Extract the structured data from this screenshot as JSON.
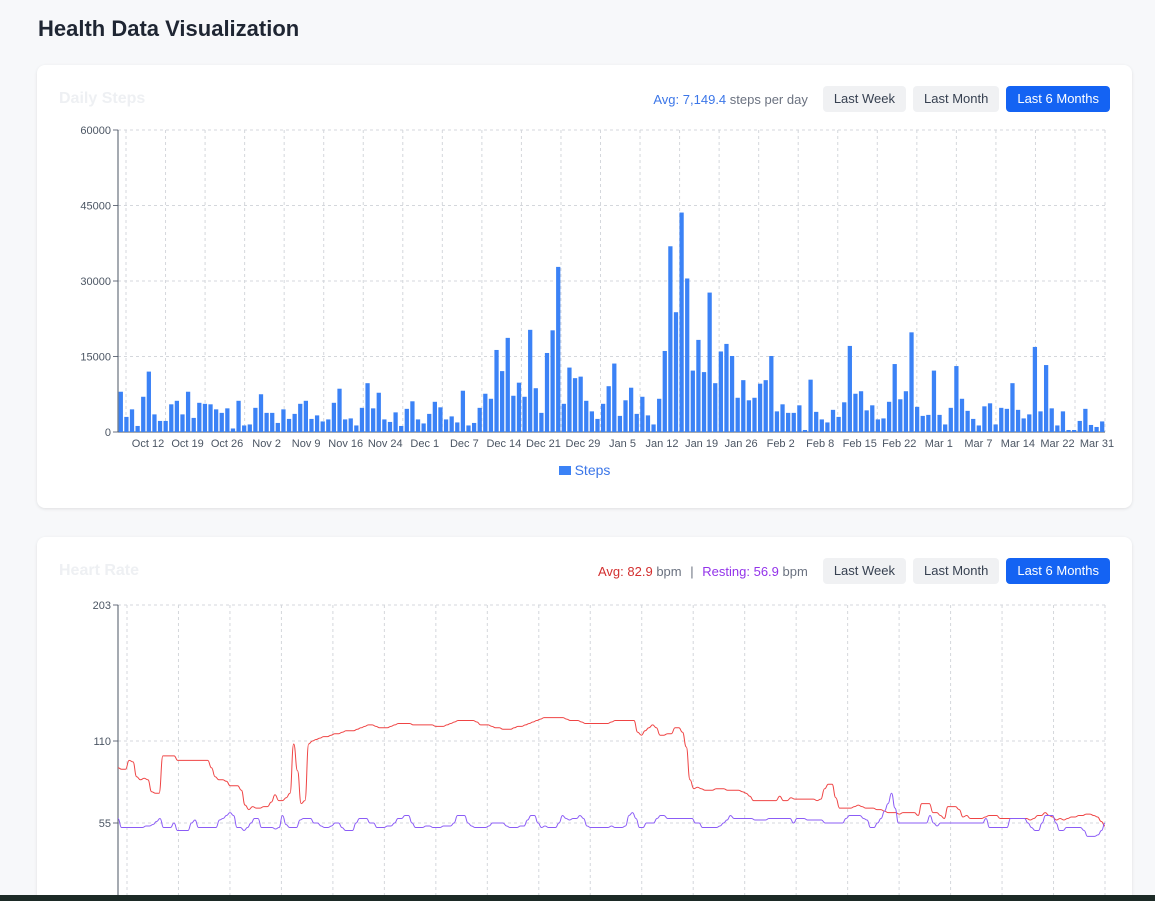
{
  "page": {
    "title": "Health Data Visualization"
  },
  "steps_panel": {
    "title": "Daily Steps",
    "avg_label": "Avg:",
    "avg_value": "7,149.4",
    "avg_unit": "steps per day",
    "buttons": [
      "Last Week",
      "Last Month",
      "Last 6 Months"
    ],
    "active_button": "Last 6 Months",
    "legend": "Steps"
  },
  "hr_panel": {
    "title": "Heart Rate",
    "avg_label": "Avg:",
    "avg_value": "82.9",
    "avg_unit": "bpm",
    "separator": "|",
    "resting_label": "Resting:",
    "resting_value": "56.9",
    "resting_unit": "bpm",
    "buttons": [
      "Last Week",
      "Last Month",
      "Last 6 Months"
    ],
    "active_button": "Last 6 Months"
  },
  "colors": {
    "steps_bar": "#3b82f6",
    "hr_avg": "#ef4444",
    "hr_resting": "#8b5cf6",
    "accent": "#1463f3"
  },
  "chart_data": [
    {
      "type": "bar",
      "title": "Daily Steps",
      "ylim": [
        0,
        60000
      ],
      "y_ticks": [
        0,
        15000,
        30000,
        45000,
        60000
      ],
      "x_ticks": [
        "Oct 12",
        "Oct 19",
        "Oct 26",
        "Nov 2",
        "Nov 9",
        "Nov 16",
        "Nov 24",
        "Dec 1",
        "Dec 7",
        "Dec 14",
        "Dec 21",
        "Dec 29",
        "Jan 5",
        "Jan 12",
        "Jan 19",
        "Jan 26",
        "Feb 2",
        "Feb 8",
        "Feb 15",
        "Feb 22",
        "Mar 1",
        "Mar 7",
        "Mar 14",
        "Mar 22",
        "Mar 31"
      ],
      "grid": true,
      "legend_position": "bottom",
      "series": [
        {
          "name": "Steps",
          "values": [
            8000,
            3000,
            4500,
            1200,
            7000,
            12000,
            3500,
            2200,
            2200,
            5500,
            6200,
            3500,
            8000,
            2800,
            5800,
            5600,
            5500,
            4500,
            3800,
            4700,
            700,
            6200,
            1300,
            1500,
            4800,
            7500,
            3800,
            3800,
            1800,
            4500,
            2600,
            3600,
            5600,
            6200,
            2600,
            3300,
            2100,
            2500,
            5800,
            8600,
            2500,
            2700,
            1300,
            4800,
            9700,
            4700,
            7800,
            2500,
            2000,
            3900,
            1200,
            4600,
            6100,
            2500,
            1700,
            3600,
            6000,
            4900,
            2500,
            3100,
            1900,
            8200,
            1300,
            1800,
            4800,
            7600,
            6600,
            16300,
            12100,
            18700,
            7200,
            9800,
            7000,
            20300,
            8700,
            3800,
            15700,
            20200,
            32800,
            5600,
            12800,
            10700,
            11000,
            6200,
            4100,
            2600,
            5600,
            9100,
            13600,
            3200,
            6300,
            8800,
            3600,
            7000,
            3300,
            1500,
            6600,
            16100,
            36900,
            23800,
            43600,
            30500,
            12200,
            18300,
            11900,
            27700,
            9700,
            16000,
            17500,
            15100,
            6800,
            10300,
            6300,
            6800,
            9600,
            10300,
            15100,
            4100,
            5500,
            3800,
            3800,
            5300,
            400,
            10400,
            4000,
            2500,
            1900,
            4400,
            3000,
            5900,
            17100,
            7600,
            8100,
            4300,
            5300,
            2500,
            2700,
            6000,
            13500,
            6500,
            8100,
            19800,
            5000,
            3200,
            3400,
            12200,
            3400,
            1500,
            4800,
            13100,
            6600,
            4200,
            2600,
            1300,
            5100,
            5700,
            1500,
            4800,
            4600,
            9700,
            4400,
            2700,
            3500,
            16900,
            4100,
            13300,
            4700,
            1300,
            4100,
            400,
            400,
            2200,
            4600,
            1400,
            1000,
            2100
          ]
        }
      ]
    },
    {
      "type": "line",
      "title": "Heart Rate",
      "y_ticks": [
        55,
        110,
        203
      ],
      "series": [
        {
          "name": "Avg",
          "values": [
            92,
            91,
            91,
            97,
            96,
            86,
            84,
            85,
            84,
            76,
            75,
            75,
            100,
            100,
            100,
            100,
            97,
            97,
            97,
            97,
            97,
            97,
            97,
            97,
            97,
            92,
            86,
            84,
            84,
            83,
            80,
            80,
            80,
            77,
            67,
            64,
            66,
            65,
            65,
            66,
            66,
            69,
            74,
            70,
            70,
            72,
            75,
            108,
            90,
            68,
            70,
            108,
            110,
            111,
            112,
            113,
            113,
            114,
            115,
            115,
            116,
            117,
            117,
            117,
            118,
            119,
            120,
            121,
            121,
            120,
            119,
            119,
            119,
            120,
            121,
            122,
            122,
            122,
            122,
            121,
            121,
            121,
            121,
            121,
            121,
            120,
            120,
            120,
            121,
            122,
            123,
            124,
            124,
            124,
            124,
            124,
            123,
            121,
            121,
            121,
            120,
            119,
            119,
            118,
            118,
            118,
            119,
            120,
            120,
            121,
            122,
            123,
            124,
            125,
            126,
            126,
            126,
            126,
            126,
            126,
            125,
            124,
            124,
            124,
            123,
            122,
            122,
            122,
            122,
            122,
            122,
            122,
            123,
            124,
            124,
            124,
            124,
            124,
            124,
            116,
            114,
            117,
            119,
            121,
            119,
            114,
            114,
            115,
            115,
            119,
            119,
            116,
            106,
            84,
            78,
            79,
            78,
            77,
            77,
            77,
            78,
            78,
            78,
            77,
            77,
            77,
            77,
            76,
            75,
            73,
            70,
            70,
            70,
            70,
            70,
            70,
            70,
            73,
            70,
            70,
            72,
            71,
            71,
            71,
            71,
            71,
            71,
            70,
            71,
            78,
            81,
            81,
            72,
            65,
            65,
            65,
            65,
            66,
            67,
            66,
            65,
            65,
            65,
            64,
            64,
            63,
            62,
            62,
            62,
            61,
            62,
            62,
            62,
            62,
            60,
            68,
            68,
            68,
            62,
            62,
            60,
            58,
            66,
            66,
            66,
            64,
            59,
            60,
            58,
            58,
            58,
            58,
            59,
            60,
            60,
            60,
            58,
            58,
            58,
            58,
            58,
            58,
            58,
            58,
            57,
            58,
            60,
            60,
            62,
            60,
            59,
            57,
            58,
            57,
            58,
            59,
            59,
            60,
            60,
            61,
            61,
            60,
            59,
            56,
            53
          ]
        },
        {
          "name": "Resting",
          "values": [
            58,
            52,
            52,
            52,
            52,
            52,
            52,
            52,
            53,
            53,
            54,
            56,
            58,
            52,
            52,
            52,
            55,
            50,
            50,
            50,
            50,
            55,
            57,
            52,
            52,
            52,
            52,
            52,
            52,
            57,
            58,
            60,
            62,
            60,
            52,
            52,
            50,
            52,
            55,
            58,
            58,
            52,
            52,
            52,
            52,
            51,
            52,
            60,
            54,
            52,
            52,
            52,
            57,
            58,
            58,
            58,
            55,
            55,
            53,
            52,
            52,
            53,
            55,
            55,
            52,
            50,
            50,
            50,
            55,
            58,
            58,
            58,
            55,
            55,
            52,
            52,
            52,
            53,
            53,
            55,
            58,
            58,
            60,
            60,
            55,
            52,
            52,
            52,
            53,
            53,
            52,
            52,
            52,
            53,
            53,
            53,
            55,
            60,
            60,
            60,
            55,
            53,
            52,
            52,
            52,
            52,
            53,
            55,
            55,
            55,
            55,
            53,
            52,
            52,
            52,
            53,
            53,
            57,
            60,
            60,
            55,
            52,
            53,
            52,
            52,
            52,
            55,
            60,
            58,
            57,
            58,
            58,
            60,
            58,
            53,
            52,
            52,
            52,
            52,
            52,
            52,
            53,
            52,
            52,
            52,
            53,
            60,
            62,
            58,
            52,
            52,
            55,
            55,
            55,
            58,
            60,
            60,
            58,
            58,
            58,
            58,
            58,
            58,
            58,
            58,
            55,
            55,
            52,
            52,
            52,
            52,
            52,
            53,
            55,
            57,
            60,
            58,
            58,
            58,
            58,
            58,
            58,
            57,
            57,
            57,
            57,
            58,
            58,
            58,
            58,
            58,
            58,
            58,
            55,
            58,
            58,
            58,
            57,
            57,
            57,
            57,
            57,
            55,
            55,
            55,
            55,
            55,
            55,
            58,
            60,
            60,
            60,
            60,
            58,
            57,
            52,
            52,
            55,
            58,
            63,
            68,
            75,
            65,
            55,
            55,
            55,
            55,
            55,
            55,
            55,
            55,
            55,
            60,
            55,
            53,
            55,
            55,
            55,
            55,
            55,
            55,
            55,
            55,
            55,
            55,
            55,
            55,
            55,
            58,
            52,
            52,
            52,
            52,
            52,
            52,
            58,
            58,
            58,
            58,
            58,
            55,
            52,
            50,
            50,
            55,
            60,
            60,
            60,
            55,
            50,
            50,
            52,
            52,
            52,
            52,
            52,
            50,
            46,
            46,
            46,
            47,
            50,
            55
          ]
        }
      ]
    }
  ]
}
